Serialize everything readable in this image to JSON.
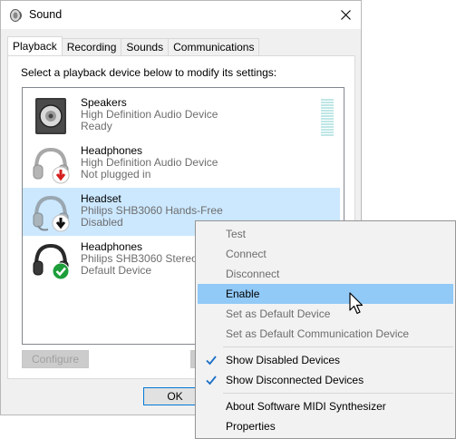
{
  "window": {
    "title": "Sound"
  },
  "tabs": [
    {
      "label": "Playback",
      "active": true
    },
    {
      "label": "Recording"
    },
    {
      "label": "Sounds"
    },
    {
      "label": "Communications"
    }
  ],
  "instruction": "Select a playback device below to modify its settings:",
  "devices": [
    {
      "name": "Speakers",
      "desc": "High Definition Audio Device",
      "status": "Ready",
      "icon": "speaker-icon"
    },
    {
      "name": "Headphones",
      "desc": "High Definition Audio Device",
      "status": "Not plugged in",
      "icon": "headphones-unplugged-icon"
    },
    {
      "name": "Headset",
      "desc": "Philips SHB3060 Hands-Free",
      "status": "Disabled",
      "icon": "headset-disabled-icon",
      "selected": true
    },
    {
      "name": "Headphones",
      "desc": "Philips SHB3060 Stereo",
      "status": "Default Device",
      "icon": "headphones-default-icon"
    }
  ],
  "buttons": {
    "configure": "Configure",
    "ok": "OK"
  },
  "context_menu": {
    "items": [
      {
        "label": "Test",
        "disabled": true
      },
      {
        "label": "Connect",
        "disabled": true
      },
      {
        "label": "Disconnect",
        "disabled": true
      },
      {
        "label": "Enable",
        "highlighted": true
      },
      {
        "label": "Set as Default Device",
        "disabled": true
      },
      {
        "label": "Set as Default Communication Device",
        "disabled": true
      },
      {
        "label": "Show Disabled Devices",
        "checked": true
      },
      {
        "label": "Show Disconnected Devices",
        "checked": true
      },
      {
        "label": "About Software MIDI Synthesizer"
      },
      {
        "label": "Properties"
      }
    ]
  },
  "colors": {
    "selection": "#cce8ff",
    "menu_highlight": "#91c9f7",
    "check": "#1a6fc7",
    "default_badge": "#1e9e3a",
    "unplugged_badge": "#d42020"
  }
}
